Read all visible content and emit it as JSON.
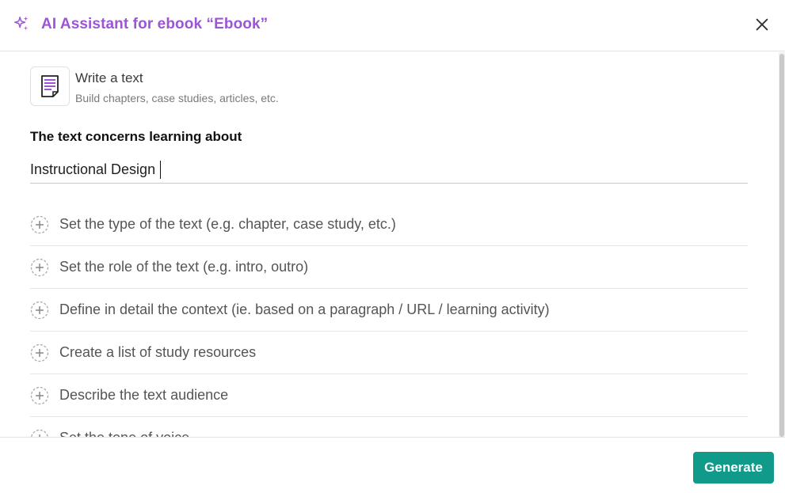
{
  "header": {
    "title": "AI Assistant for ebook “Ebook”",
    "icon": "sparkle-icon",
    "close_icon": "close-icon",
    "accent_color": "#9b55d6"
  },
  "type_card": {
    "title": "Write a text",
    "subtitle": "Build chapters, case studies, articles, etc.",
    "icon": "document-icon"
  },
  "topic": {
    "label": "The text concerns learning about",
    "value": "Instructional Design"
  },
  "options": [
    {
      "label": "Set the type of the text (e.g. chapter, case study, etc.)"
    },
    {
      "label": "Set the role of the text (e.g. intro, outro)"
    },
    {
      "label": "Define in detail the context (ie. based on a paragraph / URL / learning activity)"
    },
    {
      "label": "Create a list of study resources"
    },
    {
      "label": "Describe the text audience"
    },
    {
      "label": "Set the tone of voice"
    }
  ],
  "footer": {
    "generate_label": "Generate",
    "button_color": "#0f9a8a"
  }
}
